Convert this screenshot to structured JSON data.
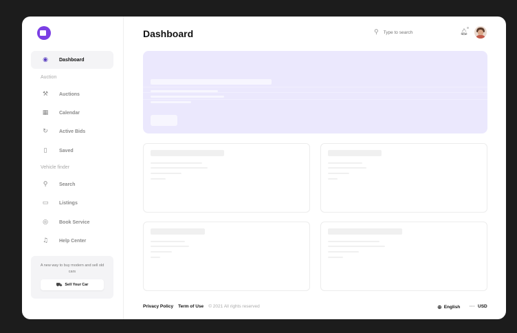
{
  "header": {
    "title": "Dashboard"
  },
  "search": {
    "placeholder": "Type to search",
    "icon": "search-icon"
  },
  "sidebar": {
    "logo_icon": "car-logo-icon",
    "active": {
      "label": "Dashboard",
      "icon": "compass-icon"
    },
    "sections": [
      {
        "title": "Auction",
        "items": [
          {
            "label": "Auctions",
            "icon": "gavel-icon"
          },
          {
            "label": "Calendar",
            "icon": "calendar-icon"
          },
          {
            "label": "Active Bids",
            "icon": "refresh-icon"
          },
          {
            "label": "Saved",
            "icon": "bookmark-icon"
          }
        ]
      },
      {
        "title": "Vehicle finder",
        "items": [
          {
            "label": "Search",
            "icon": "search-icon"
          },
          {
            "label": "Listings",
            "icon": "laptop-icon"
          },
          {
            "label": "Book Service",
            "icon": "target-icon"
          },
          {
            "label": "Help Center",
            "icon": "headset-icon"
          }
        ]
      }
    ],
    "promo": {
      "text": "A new way to buy modern and sell old cars",
      "button_label": "Sell Your Car"
    }
  },
  "footer": {
    "links": [
      "Privacy Policy",
      "Term of Use"
    ],
    "copyright": "© 2021 All rights reserved",
    "language": "English",
    "currency": "USD"
  },
  "colors": {
    "accent": "#7b3fe4",
    "hero_bg": "#ebe8fd",
    "frame_bg": "#ffffff",
    "outer_bg": "#1c1c1c"
  }
}
